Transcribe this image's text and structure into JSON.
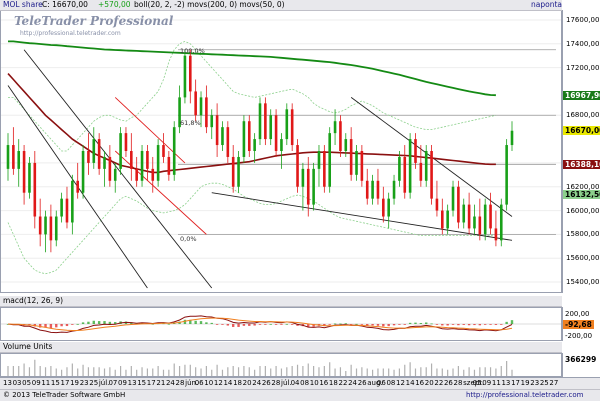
{
  "header": {
    "symbol": "MOL share",
    "last_label": "C: 16670,00",
    "change": "+570,00",
    "indicators": "boll(20, 2, -2) movs(200, 0) movs(50, 0)",
    "period": "naponta"
  },
  "watermark": {
    "title": "TeleTrader Professional",
    "sub": "http://professional.teletrader.com"
  },
  "panes": {
    "macd": {
      "title": "macd(12, 26, 9)",
      "value_tag": "-92,68"
    },
    "volume": {
      "title": "Volume Units",
      "value_tag": "366299"
    }
  },
  "price_axis": {
    "ticks": [
      "17600,00",
      "17400,00",
      "17200,00",
      "16800,00",
      "16400,00",
      "16200,00",
      "16000,00",
      "15800,00",
      "15600,00",
      "15400,00"
    ],
    "tags": [
      {
        "label": "16967,90",
        "color": "#1a7a1a"
      },
      {
        "label": "16670,00",
        "color": "#e8e800"
      },
      {
        "label": "16388,10",
        "color": "#8a1010"
      },
      {
        "label": "16132,50",
        "color": "#8cd08c"
      }
    ]
  },
  "macd_axis": {
    "ticks": [
      "200,00",
      "-200,00"
    ]
  },
  "fib_labels": [
    "100,0%",
    "61,8%",
    "0,0%"
  ],
  "x_axis": {
    "ticks": [
      "13",
      "03",
      "05",
      "09",
      "11",
      "15",
      "17",
      "19",
      "23",
      "25",
      "júl.",
      "07",
      "09",
      "13",
      "15",
      "17",
      "21",
      "24",
      "28",
      "jún.",
      "06",
      "10",
      "12",
      "14",
      "18",
      "20",
      "24",
      "26",
      "28",
      "júl.",
      "04",
      "08",
      "10",
      "16",
      "18",
      "22",
      "24",
      "26",
      "aug.",
      "06",
      "08",
      "12",
      "14",
      "16",
      "20",
      "22",
      "26",
      "28",
      "szept.",
      "05",
      "09",
      "11",
      "13",
      "17",
      "19",
      "23",
      "25",
      "27"
    ]
  },
  "footer": {
    "copyright": "© 2013 TeleTrader Software GmbH",
    "url": "http://professional.teletrader.com"
  },
  "colors": {
    "up": "#18a018",
    "down": "#e01818",
    "ma200": "#148a14",
    "ma50": "#8a1010",
    "boll": "#8cd08c",
    "trend": "#222222",
    "channel": "#e02020",
    "macd": "#8a1010",
    "signal": "#f08020"
  },
  "chart_data": {
    "type": "candlestick",
    "y_range": [
      15350,
      17650
    ],
    "candles": [
      {
        "o": 16350,
        "h": 16650,
        "l": 16250,
        "c": 16550
      },
      {
        "o": 16550,
        "h": 16700,
        "l": 16300,
        "c": 16350
      },
      {
        "o": 16350,
        "h": 16600,
        "l": 16200,
        "c": 16500
      },
      {
        "o": 16500,
        "h": 16550,
        "l": 16050,
        "c": 16150
      },
      {
        "o": 16150,
        "h": 16450,
        "l": 16100,
        "c": 16400
      },
      {
        "o": 16400,
        "h": 16500,
        "l": 15850,
        "c": 15950
      },
      {
        "o": 15950,
        "h": 16100,
        "l": 15700,
        "c": 15800
      },
      {
        "o": 15800,
        "h": 16000,
        "l": 15650,
        "c": 15950
      },
      {
        "o": 15950,
        "h": 16050,
        "l": 15650,
        "c": 15750
      },
      {
        "o": 15750,
        "h": 16000,
        "l": 15700,
        "c": 15950
      },
      {
        "o": 15950,
        "h": 16150,
        "l": 15900,
        "c": 16100
      },
      {
        "o": 16100,
        "h": 16200,
        "l": 15850,
        "c": 15900
      },
      {
        "o": 15900,
        "h": 16300,
        "l": 15800,
        "c": 16250
      },
      {
        "o": 16250,
        "h": 16400,
        "l": 16100,
        "c": 16150
      },
      {
        "o": 16150,
        "h": 16550,
        "l": 16100,
        "c": 16500
      },
      {
        "o": 16500,
        "h": 16650,
        "l": 16300,
        "c": 16400
      },
      {
        "o": 16400,
        "h": 16700,
        "l": 16350,
        "c": 16600
      },
      {
        "o": 16600,
        "h": 16650,
        "l": 16300,
        "c": 16350
      },
      {
        "o": 16350,
        "h": 16500,
        "l": 16200,
        "c": 16450
      },
      {
        "o": 16450,
        "h": 16550,
        "l": 16200,
        "c": 16250
      },
      {
        "o": 16250,
        "h": 16400,
        "l": 16150,
        "c": 16350
      },
      {
        "o": 16350,
        "h": 16700,
        "l": 16300,
        "c": 16650
      },
      {
        "o": 16650,
        "h": 16700,
        "l": 16450,
        "c": 16500
      },
      {
        "o": 16500,
        "h": 16650,
        "l": 16250,
        "c": 16350
      },
      {
        "o": 16350,
        "h": 16450,
        "l": 16200,
        "c": 16250
      },
      {
        "o": 16250,
        "h": 16550,
        "l": 16200,
        "c": 16500
      },
      {
        "o": 16500,
        "h": 16550,
        "l": 16250,
        "c": 16350
      },
      {
        "o": 16350,
        "h": 16450,
        "l": 16150,
        "c": 16250
      },
      {
        "o": 16250,
        "h": 16600,
        "l": 16200,
        "c": 16550
      },
      {
        "o": 16550,
        "h": 16650,
        "l": 16400,
        "c": 16450
      },
      {
        "o": 16450,
        "h": 16500,
        "l": 16250,
        "c": 16300
      },
      {
        "o": 16300,
        "h": 16750,
        "l": 16250,
        "c": 16700
      },
      {
        "o": 16700,
        "h": 17050,
        "l": 16650,
        "c": 16950
      },
      {
        "o": 16950,
        "h": 17350,
        "l": 16900,
        "c": 17300
      },
      {
        "o": 17300,
        "h": 17350,
        "l": 16900,
        "c": 17000
      },
      {
        "o": 17000,
        "h": 17100,
        "l": 16750,
        "c": 16800
      },
      {
        "o": 16800,
        "h": 17000,
        "l": 16700,
        "c": 16950
      },
      {
        "o": 16950,
        "h": 17050,
        "l": 16650,
        "c": 16700
      },
      {
        "o": 16700,
        "h": 16850,
        "l": 16600,
        "c": 16800
      },
      {
        "o": 16800,
        "h": 16900,
        "l": 16450,
        "c": 16550
      },
      {
        "o": 16550,
        "h": 16750,
        "l": 16500,
        "c": 16700
      },
      {
        "o": 16700,
        "h": 16750,
        "l": 16400,
        "c": 16450
      },
      {
        "o": 16450,
        "h": 16550,
        "l": 16150,
        "c": 16200
      },
      {
        "o": 16200,
        "h": 16500,
        "l": 16150,
        "c": 16450
      },
      {
        "o": 16450,
        "h": 16800,
        "l": 16400,
        "c": 16750
      },
      {
        "o": 16750,
        "h": 16800,
        "l": 16450,
        "c": 16500
      },
      {
        "o": 16500,
        "h": 16650,
        "l": 16400,
        "c": 16600
      },
      {
        "o": 16600,
        "h": 16950,
        "l": 16550,
        "c": 16900
      },
      {
        "o": 16900,
        "h": 16950,
        "l": 16550,
        "c": 16600
      },
      {
        "o": 16600,
        "h": 16850,
        "l": 16550,
        "c": 16800
      },
      {
        "o": 16800,
        "h": 16850,
        "l": 16450,
        "c": 16500
      },
      {
        "o": 16500,
        "h": 16650,
        "l": 16350,
        "c": 16600
      },
      {
        "o": 16600,
        "h": 16900,
        "l": 16550,
        "c": 16850
      },
      {
        "o": 16850,
        "h": 16900,
        "l": 16500,
        "c": 16550
      },
      {
        "o": 16550,
        "h": 16600,
        "l": 16150,
        "c": 16200
      },
      {
        "o": 16200,
        "h": 16400,
        "l": 16000,
        "c": 16350
      },
      {
        "o": 16350,
        "h": 16450,
        "l": 15950,
        "c": 16050
      },
      {
        "o": 16050,
        "h": 16400,
        "l": 16000,
        "c": 16350
      },
      {
        "o": 16350,
        "h": 16550,
        "l": 16200,
        "c": 16500
      },
      {
        "o": 16500,
        "h": 16550,
        "l": 16150,
        "c": 16200
      },
      {
        "o": 16200,
        "h": 16700,
        "l": 16150,
        "c": 16650
      },
      {
        "o": 16650,
        "h": 16850,
        "l": 16550,
        "c": 16750
      },
      {
        "o": 16750,
        "h": 16800,
        "l": 16450,
        "c": 16500
      },
      {
        "o": 16500,
        "h": 16650,
        "l": 16450,
        "c": 16600
      },
      {
        "o": 16600,
        "h": 16700,
        "l": 16250,
        "c": 16300
      },
      {
        "o": 16300,
        "h": 16550,
        "l": 16250,
        "c": 16500
      },
      {
        "o": 16500,
        "h": 16550,
        "l": 16200,
        "c": 16250
      },
      {
        "o": 16250,
        "h": 16350,
        "l": 16050,
        "c": 16100
      },
      {
        "o": 16100,
        "h": 16300,
        "l": 16050,
        "c": 16250
      },
      {
        "o": 16250,
        "h": 16350,
        "l": 16050,
        "c": 16100
      },
      {
        "o": 16100,
        "h": 16200,
        "l": 15900,
        "c": 15950
      },
      {
        "o": 15950,
        "h": 16150,
        "l": 15850,
        "c": 16100
      },
      {
        "o": 16100,
        "h": 16300,
        "l": 16050,
        "c": 16250
      },
      {
        "o": 16250,
        "h": 16500,
        "l": 16200,
        "c": 16450
      },
      {
        "o": 16450,
        "h": 16550,
        "l": 16100,
        "c": 16150
      },
      {
        "o": 16150,
        "h": 16650,
        "l": 16100,
        "c": 16600
      },
      {
        "o": 16600,
        "h": 16650,
        "l": 16350,
        "c": 16400
      },
      {
        "o": 16400,
        "h": 16550,
        "l": 16200,
        "c": 16250
      },
      {
        "o": 16250,
        "h": 16550,
        "l": 16200,
        "c": 16500
      },
      {
        "o": 16500,
        "h": 16550,
        "l": 16050,
        "c": 16100
      },
      {
        "o": 16100,
        "h": 16250,
        "l": 15950,
        "c": 16000
      },
      {
        "o": 16000,
        "h": 16100,
        "l": 15800,
        "c": 15850
      },
      {
        "o": 15850,
        "h": 16050,
        "l": 15800,
        "c": 16000
      },
      {
        "o": 16000,
        "h": 16250,
        "l": 15950,
        "c": 16200
      },
      {
        "o": 16200,
        "h": 16250,
        "l": 15850,
        "c": 15900
      },
      {
        "o": 15900,
        "h": 16100,
        "l": 15850,
        "c": 16050
      },
      {
        "o": 16050,
        "h": 16150,
        "l": 15800,
        "c": 15850
      },
      {
        "o": 15850,
        "h": 16050,
        "l": 15800,
        "c": 15950
      },
      {
        "o": 15950,
        "h": 16100,
        "l": 15750,
        "c": 15800
      },
      {
        "o": 15800,
        "h": 16100,
        "l": 15750,
        "c": 16050
      },
      {
        "o": 16050,
        "h": 16150,
        "l": 15800,
        "c": 15850
      },
      {
        "o": 15850,
        "h": 16000,
        "l": 15700,
        "c": 15750
      },
      {
        "o": 15750,
        "h": 16100,
        "l": 15700,
        "c": 16050
      },
      {
        "o": 16050,
        "h": 16600,
        "l": 16000,
        "c": 16550
      },
      {
        "o": 16550,
        "h": 16750,
        "l": 16500,
        "c": 16670
      }
    ],
    "ma200": [
      17420,
      17420,
      17415,
      17410,
      17405,
      17402,
      17398,
      17394,
      17390,
      17388,
      17385,
      17380,
      17376,
      17372,
      17368,
      17364,
      17360,
      17356,
      17352,
      17350,
      17348,
      17346,
      17344,
      17342,
      17340,
      17338,
      17336,
      17334,
      17332,
      17330,
      17328,
      17326,
      17324,
      17322,
      17320,
      17318,
      17316,
      17314,
      17312,
      17310,
      17308,
      17306,
      17304,
      17302,
      17300,
      17298,
      17296,
      17294,
      17292,
      17290,
      17286,
      17282,
      17278,
      17274,
      17270,
      17266,
      17262,
      17258,
      17254,
      17250,
      17246,
      17240,
      17234,
      17228,
      17222,
      17214,
      17206,
      17198,
      17190,
      17180,
      17170,
      17160,
      17150,
      17140,
      17128,
      17116,
      17104,
      17092,
      17080,
      17070,
      17060,
      17050,
      17040,
      17030,
      17020,
      17010,
      17000,
      16992,
      16984,
      16976,
      16970,
      16968
    ],
    "ma50": [
      17150,
      17100,
      17050,
      17000,
      16950,
      16900,
      16850,
      16800,
      16760,
      16720,
      16680,
      16640,
      16600,
      16570,
      16540,
      16510,
      16480,
      16460,
      16440,
      16420,
      16400,
      16380,
      16370,
      16360,
      16350,
      16340,
      16330,
      16320,
      16320,
      16330,
      16335,
      16340,
      16345,
      16350,
      16355,
      16360,
      16365,
      16370,
      16375,
      16380,
      16385,
      16390,
      16395,
      16400,
      16405,
      16410,
      16420,
      16430,
      16440,
      16450,
      16460,
      16465,
      16470,
      16475,
      16480,
      16485,
      16488,
      16490,
      16490,
      16490,
      16490,
      16488,
      16486,
      16484,
      16482,
      16480,
      16478,
      16476,
      16474,
      16472,
      16470,
      16468,
      16466,
      16464,
      16462,
      16460,
      16455,
      16450,
      16445,
      16440,
      16435,
      16430,
      16425,
      16420,
      16415,
      16410,
      16405,
      16400,
      16395,
      16390,
      16388,
      16388
    ],
    "boll_upper": [
      16950,
      16950,
      16900,
      16850,
      16800,
      16750,
      16700,
      16650,
      16600,
      16550,
      16500,
      16500,
      16550,
      16600,
      16650,
      16700,
      16750,
      16780,
      16800,
      16800,
      16780,
      16760,
      16750,
      16780,
      16800,
      16850,
      16900,
      16950,
      17000,
      17100,
      17250,
      17350,
      17400,
      17420,
      17400,
      17350,
      17300,
      17250,
      17200,
      17150,
      17100,
      17050,
      17000,
      16980,
      16970,
      16960,
      16950,
      16960,
      16970,
      16980,
      16990,
      17000,
      17010,
      17020,
      17000,
      16980,
      16950,
      16900,
      16870,
      16850,
      16830,
      16820,
      16830,
      16850,
      16880,
      16900,
      16920,
      16900,
      16880,
      16850,
      16820,
      16800,
      16780,
      16760,
      16740,
      16720,
      16700,
      16690,
      16680,
      16680,
      16690,
      16700,
      16710,
      16720,
      16730,
      16740,
      16750,
      16760,
      16770,
      16780,
      16790,
      16800
    ],
    "boll_lower": [
      15900,
      15800,
      15700,
      15600,
      15550,
      15500,
      15480,
      15470,
      15480,
      15500,
      15550,
      15600,
      15650,
      15700,
      15750,
      15800,
      15850,
      15900,
      15950,
      16000,
      16050,
      16100,
      16120,
      16100,
      16080,
      16050,
      16020,
      16000,
      15990,
      15980,
      15990,
      16000,
      16020,
      16050,
      16100,
      16150,
      16200,
      16220,
      16230,
      16230,
      16220,
      16200,
      16180,
      16150,
      16120,
      16100,
      16080,
      16060,
      16050,
      16050,
      16060,
      16080,
      16100,
      16120,
      16130,
      16120,
      16100,
      16080,
      16050,
      16020,
      15990,
      15960,
      15940,
      15930,
      15920,
      15910,
      15900,
      15890,
      15880,
      15870,
      15860,
      15850,
      15840,
      15830,
      15820,
      15810,
      15800,
      15790,
      15790,
      15790,
      15790,
      15790,
      15790,
      15790,
      15790,
      15790,
      15790,
      15790,
      15790,
      15790,
      15790,
      15800
    ],
    "fibonacci": [
      {
        "label": "100,0%",
        "value": 17350
      },
      {
        "label": "61,8%",
        "value": 16800
      },
      {
        "label": "0,0%",
        "value": 15800
      }
    ],
    "horizontal_levels": [
      16388.1
    ]
  }
}
